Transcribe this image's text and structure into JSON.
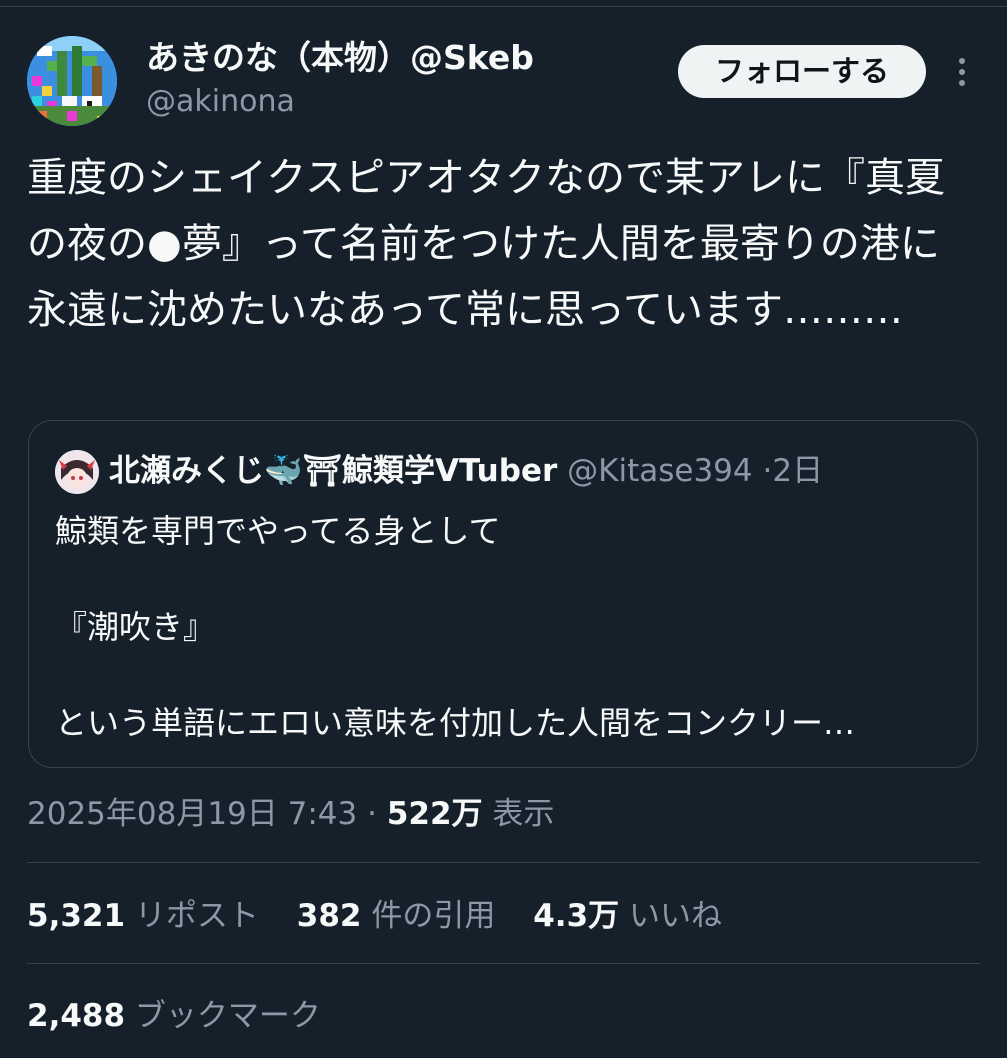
{
  "author": {
    "display_name": "あきのな（本物）@Skeb",
    "handle": "@akinona",
    "follow_label": "フォローする",
    "avatar_icon": "pixel-art-avatar-icon"
  },
  "tweet": {
    "text": "重度のシェイクスピアオタクなので某アレに『真夏の夜の●夢』って名前をつけた人間を最寄りの港に永遠に沈めたいなあって常に思っています………"
  },
  "quote": {
    "name": "北瀬みくじ🐳⛩鯨類学VTuber",
    "handle": "@Kitase394",
    "separator": "·",
    "date": "2日",
    "line1": "鯨類を専門でやってる身として",
    "line2": "『潮吹き』",
    "line3": "という単語にエロい意味を付加した人間をコンクリー…"
  },
  "meta": {
    "timestamp": "2025年08月19日 7:43",
    "separator": "·",
    "views": "522万",
    "views_label": "表示"
  },
  "stats": {
    "reposts_count": "5,321",
    "reposts_label": "リポスト",
    "quotes_count": "382",
    "quotes_label": "件の引用",
    "likes_count": "4.3万",
    "likes_label": "いいね",
    "bookmarks_count": "2,488",
    "bookmarks_label": "ブックマーク"
  },
  "colors": {
    "background": "#15202b",
    "text_primary": "#f7f9f9",
    "text_secondary": "#8b98a5",
    "border": "#38444d",
    "button_bg": "#eff3f4"
  }
}
